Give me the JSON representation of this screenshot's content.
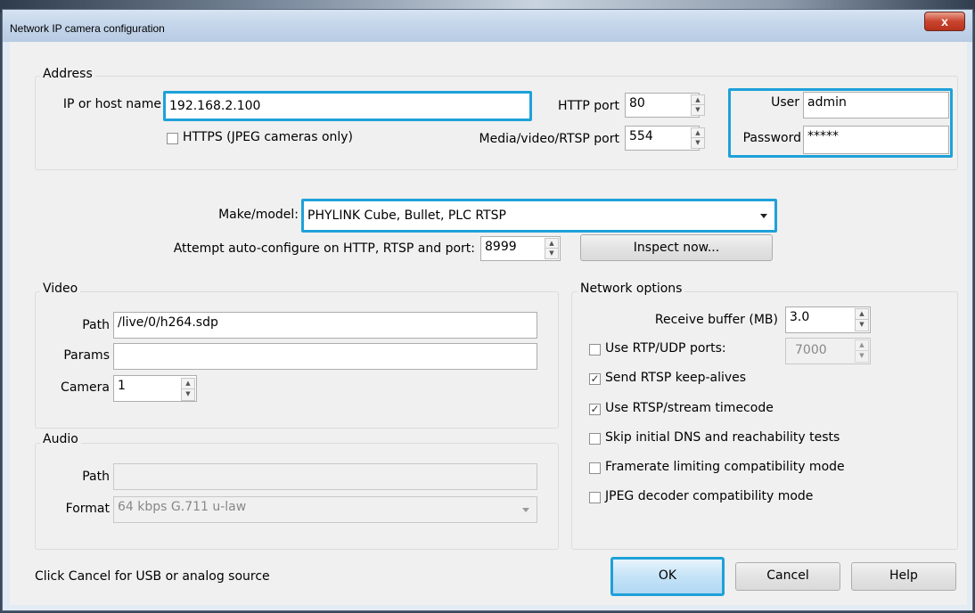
{
  "window": {
    "title": "Network IP camera configuration",
    "close_glyph": "x"
  },
  "address": {
    "group_label": "Address",
    "ip_label": "IP or host name",
    "ip_value": "192.168.2.100",
    "https_label": "HTTPS (JPEG cameras only)",
    "https_checked": false,
    "http_port_label": "HTTP port",
    "http_port_value": "80",
    "media_port_label": "Media/video/RTSP port",
    "media_port_value": "554",
    "user_label": "User",
    "user_value": "admin",
    "password_label": "Password",
    "password_value": "*****"
  },
  "make_model": {
    "label": "Make/model:",
    "value": "PHYLINK Cube, Bullet, PLC RTSP"
  },
  "autoconfig": {
    "label": "Attempt auto-configure on HTTP, RTSP and port:",
    "port_value": "8999",
    "inspect_button": "Inspect now..."
  },
  "video": {
    "group_label": "Video",
    "path_label": "Path",
    "path_value": "/live/0/h264.sdp",
    "params_label": "Params",
    "params_value": "",
    "camera_label": "Camera",
    "camera_value": "1"
  },
  "audio": {
    "group_label": "Audio",
    "path_label": "Path",
    "path_value": "",
    "format_label": "Format",
    "format_value": "64 kbps G.711 u-law"
  },
  "network": {
    "group_label": "Network options",
    "receive_buffer_label": "Receive buffer (MB)",
    "receive_buffer_value": "3.0",
    "rtp_udp_label": "Use RTP/UDP ports:",
    "rtp_udp_checked": false,
    "rtp_udp_value": "7000",
    "keepalive_label": "Send RTSP keep-alives",
    "keepalive_checked": true,
    "timecode_label": "Use RTSP/stream timecode",
    "timecode_checked": true,
    "skip_dns_label": "Skip initial DNS and reachability tests",
    "skip_dns_checked": false,
    "framerate_label": "Framerate limiting compatibility mode",
    "framerate_checked": false,
    "jpeg_label": "JPEG decoder compatibility mode",
    "jpeg_checked": false
  },
  "footer": {
    "hint": "Click Cancel for USB or analog source",
    "ok": "OK",
    "cancel": "Cancel",
    "help": "Help"
  },
  "colors": {
    "highlight": "#1ea1d9",
    "dialog_bg": "#f0f0f0"
  }
}
